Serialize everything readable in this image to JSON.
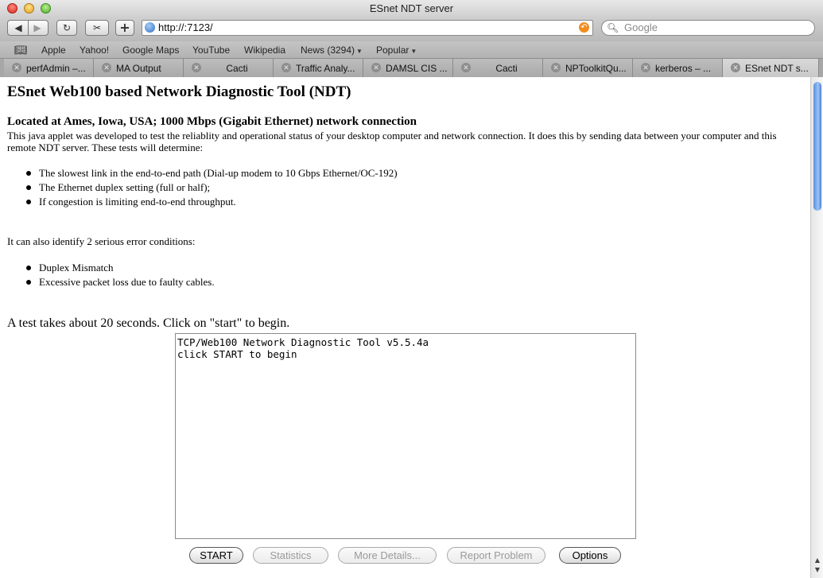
{
  "window": {
    "title": "ESnet NDT server"
  },
  "toolbar": {
    "url": "http://:7123/",
    "search_placeholder": "Google",
    "back_icon": "back-arrow-icon",
    "forward_icon": "forward-arrow-icon",
    "reload_icon": "reload-icon",
    "add_icon": "plus-icon"
  },
  "bookmarks": [
    {
      "label": "Apple"
    },
    {
      "label": "Yahoo!"
    },
    {
      "label": "Google Maps"
    },
    {
      "label": "YouTube"
    },
    {
      "label": "Wikipedia"
    },
    {
      "label": "News (3294)"
    },
    {
      "label": "Popular"
    }
  ],
  "tabs": [
    {
      "label": "perfAdmin –..."
    },
    {
      "label": "MA Output"
    },
    {
      "label": "Cacti"
    },
    {
      "label": "Traffic Analy..."
    },
    {
      "label": "DAMSL CIS ..."
    },
    {
      "label": "Cacti"
    },
    {
      "label": "NPToolkitQu..."
    },
    {
      "label": "kerberos – ..."
    },
    {
      "label": "ESnet NDT s..."
    }
  ],
  "page": {
    "heading": "ESnet Web100 based Network Diagnostic Tool (NDT)",
    "location": "Located at Ames, Iowa, USA; 1000 Mbps (Gigabit Ethernet) network connection",
    "intro": "This java applet was developed to test the reliablity and operational status of your desktop computer and network connection. It does this by sending data between your computer and this remote NDT server. These tests will determine:",
    "determines": [
      "The slowest link in the end-to-end path (Dial-up modem to 10 Gbps Ethernet/OC-192)",
      "The Ethernet duplex setting (full or half);",
      "If congestion is limiting end-to-end throughput."
    ],
    "errors_intro": "It can also identify 2 serious error conditions:",
    "errors": [
      "Duplex Mismatch",
      "Excessive packet loss due to faulty cables."
    ],
    "begin": "A test takes about 20 seconds. Click on \"start\" to begin."
  },
  "applet": {
    "lines": [
      "TCP/Web100 Network Diagnostic Tool v5.5.4a",
      "click START to begin"
    ],
    "buttons": {
      "start": "START",
      "statistics": "Statistics",
      "more_details": "More Details...",
      "report_problem": "Report Problem",
      "options": "Options"
    }
  }
}
